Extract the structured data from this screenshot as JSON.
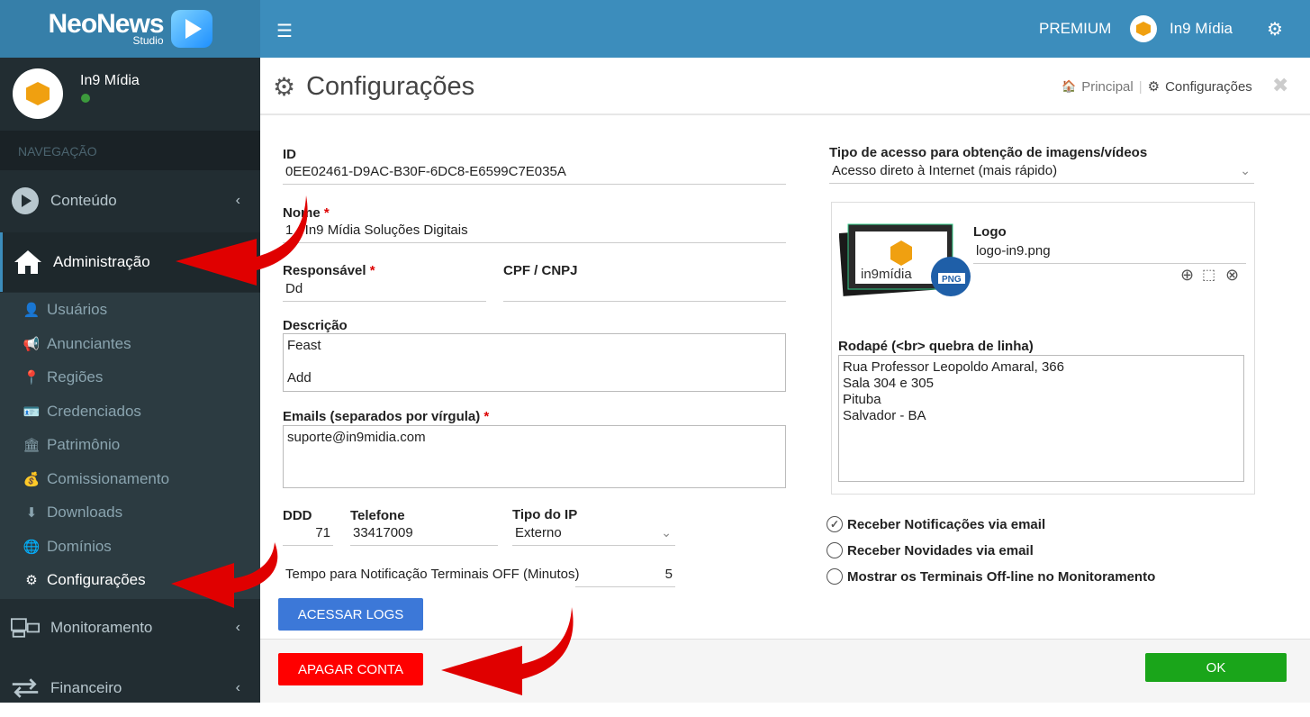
{
  "brand": {
    "name": "NeoNews",
    "sub": "Studio"
  },
  "user": {
    "name": "In9 Mídia"
  },
  "nav_header": "NAVEGAÇÃO",
  "nav": {
    "conteudo": "Conteúdo",
    "administracao": "Administração",
    "monitoramento": "Monitoramento",
    "financeiro": "Financeiro"
  },
  "submenu": [
    {
      "label": "Usuários",
      "icon": "user-icon"
    },
    {
      "label": "Anunciantes",
      "icon": "megaphone-icon"
    },
    {
      "label": "Regiões",
      "icon": "map-marker-icon"
    },
    {
      "label": "Credenciados",
      "icon": "id-card-icon"
    },
    {
      "label": "Patrimônio",
      "icon": "building-icon"
    },
    {
      "label": "Comissionamento",
      "icon": "money-bag-icon"
    },
    {
      "label": "Downloads",
      "icon": "download-icon"
    },
    {
      "label": "Domínios",
      "icon": "globe-icon"
    },
    {
      "label": "Configurações",
      "icon": "gear-icon"
    }
  ],
  "topbar": {
    "premium": "PREMIUM",
    "user": "In9 Mídia"
  },
  "page": {
    "title": "Configurações"
  },
  "breadcrumb": {
    "home": "Principal",
    "current": "Configurações"
  },
  "form": {
    "id_label": "ID",
    "id_value": "0EE02461-D9AC-B30F-6DC8-E6599C7E035A",
    "nome_label": "Nome",
    "nome_value": "1 - In9 Mídia Soluções Digitais",
    "responsavel_label": "Responsável",
    "responsavel_value": "Dd",
    "cpf_label": "CPF / CNPJ",
    "cpf_value": "",
    "descricao_label": "Descrição",
    "descricao_value": "Feast\n\nAdd",
    "emails_label": "Emails (separados por vírgula)",
    "emails_value": "suporte@in9midia.com",
    "ddd_label": "DDD",
    "ddd_value": "71",
    "telefone_label": "Telefone",
    "telefone_value": "33417009",
    "tipoip_label": "Tipo do IP",
    "tipoip_value": "Externo",
    "tempo_label": "Tempo para Notificação Terminais OFF (Minutos)",
    "tempo_value": "5",
    "acesso_label": "Tipo de acesso para obtenção de imagens/vídeos",
    "acesso_value": "Acesso direto à Internet (mais rápido)",
    "logo_label": "Logo",
    "logo_value": "logo-in9.png",
    "logo_text": "in9mídia",
    "png_badge": "PNG",
    "rodape_label": "Rodapé (<br> quebra de linha)",
    "rodape_value": "Rua Professor Leopoldo Amaral, 366\nSala 304 e 305\nPituba\nSalvador - BA",
    "opt_notificacoes": "Receber Notificações via email",
    "opt_novidades": "Receber Novidades via email",
    "opt_offline": "Mostrar os Terminais Off-line no Monitoramento"
  },
  "buttons": {
    "logs": "ACESSAR LOGS",
    "apagar": "APAGAR CONTA",
    "ok": "OK"
  },
  "colors": {
    "topbar": "#3c8dbc",
    "sidebar": "#222d32",
    "btn_logs": "#3c78d8",
    "btn_apagar": "#ff0000",
    "btn_ok": "#1aa51a",
    "arrow": "#e00000"
  }
}
